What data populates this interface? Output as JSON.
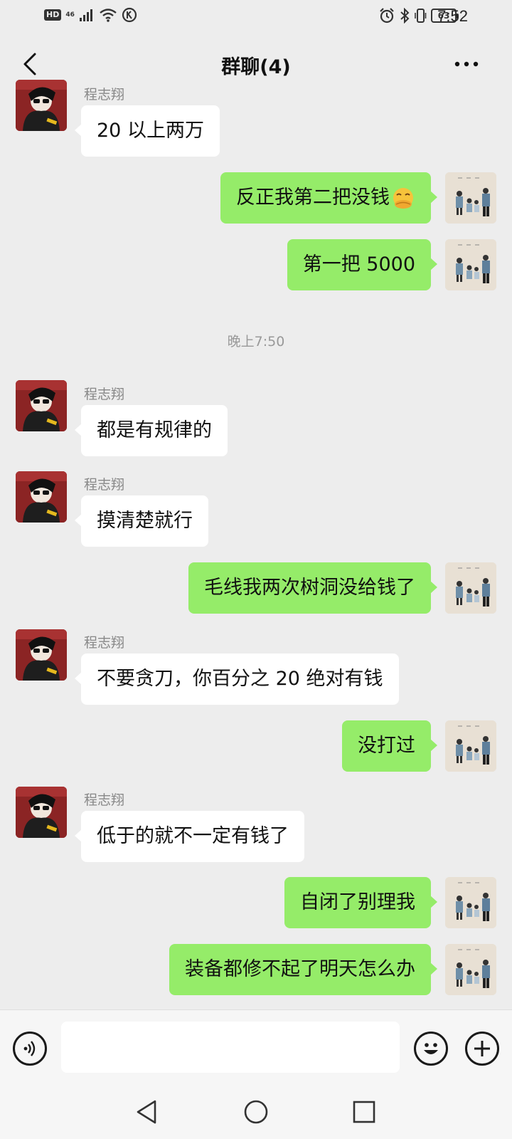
{
  "status_bar": {
    "hd": "HD",
    "network": "46",
    "battery": "63",
    "time": "7:52"
  },
  "header": {
    "title": "群聊(4)"
  },
  "messages": [
    {
      "side": "other",
      "sender": "程志翔",
      "text": "20 以上两万"
    },
    {
      "side": "self",
      "text": "反正我第二把没钱",
      "emoji": "face-with-hand-over-mouth-icon"
    },
    {
      "side": "self",
      "text": "第一把 5000"
    },
    {
      "type": "time",
      "text": "晚上7:50"
    },
    {
      "side": "other",
      "sender": "程志翔",
      "text": "都是有规律的"
    },
    {
      "side": "other",
      "sender": "程志翔",
      "text": "摸清楚就行"
    },
    {
      "side": "self",
      "text": "毛线我两次树洞没给钱了"
    },
    {
      "side": "other",
      "sender": "程志翔",
      "text": "不要贪刀，你百分之 20 绝对有钱"
    },
    {
      "side": "self",
      "text": "没打过"
    },
    {
      "side": "other",
      "sender": "程志翔",
      "text": "低于的就不一定有钱了"
    },
    {
      "side": "self",
      "text": "自闭了别理我"
    },
    {
      "side": "self",
      "text": "装备都修不起了明天怎么办"
    }
  ],
  "input": {
    "value": "",
    "placeholder": ""
  },
  "colors": {
    "background": "#ededed",
    "self_bubble": "#95ec69",
    "other_bubble": "#ffffff"
  }
}
